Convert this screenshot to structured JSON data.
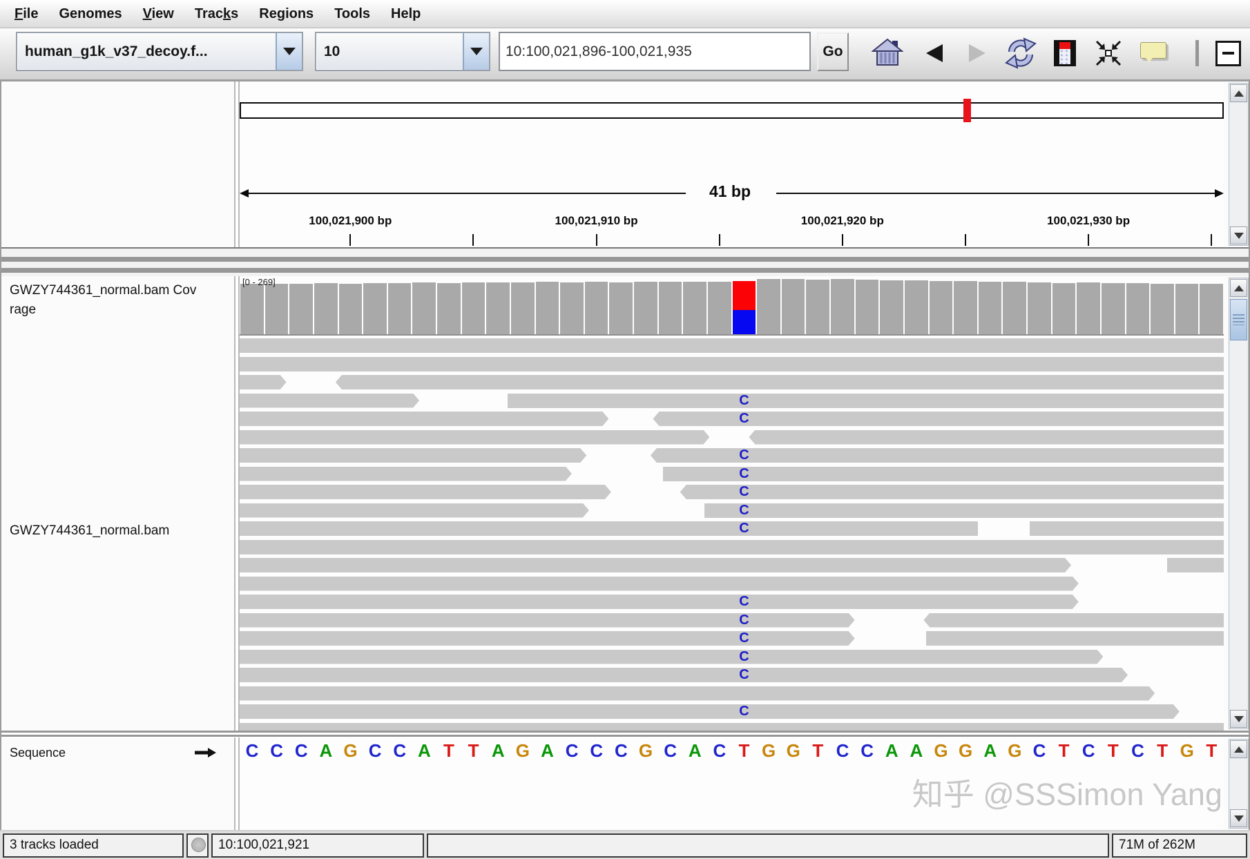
{
  "menu_bar": {
    "items": [
      {
        "label": "File",
        "underline_index": 0
      },
      {
        "label": "Genomes",
        "underline_index": -1
      },
      {
        "label": "View",
        "underline_index": 0
      },
      {
        "label": "Tracks",
        "underline_index": 4
      },
      {
        "label": "Regions",
        "underline_index": 2
      },
      {
        "label": "Tools",
        "underline_index": -1
      },
      {
        "label": "Help",
        "underline_index": -1
      }
    ]
  },
  "toolbar": {
    "genome_select": {
      "value": "human_g1k_v37_decoy.f..."
    },
    "chromosome_select": {
      "value": "10"
    },
    "locus_input": {
      "value": "10:100,021,896-100,021,935"
    },
    "go_button_label": "Go",
    "icons": [
      "home",
      "back",
      "forward",
      "refresh",
      "region-of-interest",
      "fit-to-window",
      "tooltip-toggle",
      "zoom-out"
    ]
  },
  "ruler_panel": {
    "region": {
      "chromosome": "10",
      "start": 100021896,
      "end": 100021935
    },
    "span_label": "41 bp",
    "ideogram_marker_color": "#e8131b",
    "tick_positions_bp": [
      100021900,
      100021905,
      100021910,
      100021915,
      100021920,
      100021925,
      100021930,
      100021935
    ],
    "tick_labels": [
      {
        "text": "100,021,900 bp",
        "bp": 100021900
      },
      {
        "text": "100,021,910 bp",
        "bp": 100021910
      },
      {
        "text": "100,021,920 bp",
        "bp": 100021920
      },
      {
        "text": "100,021,930 bp",
        "bp": 100021930
      }
    ]
  },
  "coverage_track": {
    "label": "GWZY744361_normal.bam Coverage",
    "label_lines": [
      "GWZY744361_normal.bam Cov",
      "rage"
    ],
    "range_label": "[0 - 269]",
    "range": [
      0,
      269
    ],
    "bar_color": "#a9a9a9",
    "variant_index": 20,
    "variant_red_fraction": 0.55,
    "variant_colors": {
      "top": "#fb0207",
      "bottom": "#0708f2"
    },
    "values": [
      244,
      247,
      245,
      249,
      246,
      250,
      248,
      251,
      249,
      252,
      253,
      251,
      254,
      252,
      255,
      253,
      256,
      254,
      257,
      255,
      258,
      269,
      268,
      267,
      268,
      266,
      264,
      262,
      260,
      258,
      256,
      254,
      252,
      250,
      251,
      248,
      249,
      246,
      247,
      245
    ]
  },
  "alignment_track": {
    "label": "GWZY744361_normal.bam",
    "read_color": "#c9c9c9",
    "mismatch_base": "C",
    "mismatch_color": "#1d1dc8",
    "mismatch_index": 20,
    "rows": [
      {
        "segments": [
          [
            0,
            40,
            ""
          ]
        ],
        "mismatch": false
      },
      {
        "segments": [
          [
            0,
            40,
            ""
          ]
        ],
        "mismatch": false
      },
      {
        "segments": [
          [
            0,
            1.9,
            "r"
          ],
          [
            3.9,
            40,
            "l"
          ]
        ],
        "mismatch": false
      },
      {
        "segments": [
          [
            0,
            7.3,
            "r"
          ],
          [
            10.9,
            40,
            ""
          ]
        ],
        "mismatch": true
      },
      {
        "segments": [
          [
            0,
            15,
            "r"
          ],
          [
            16.8,
            40,
            "l"
          ]
        ],
        "mismatch": true
      },
      {
        "segments": [
          [
            0,
            19.1,
            "r"
          ],
          [
            20.7,
            40,
            "l"
          ]
        ],
        "mismatch": false
      },
      {
        "segments": [
          [
            0,
            14.1,
            "r"
          ],
          [
            16.7,
            40,
            "l"
          ]
        ],
        "mismatch": true
      },
      {
        "segments": [
          [
            0,
            13.5,
            "r"
          ],
          [
            17.2,
            40,
            ""
          ]
        ],
        "mismatch": true
      },
      {
        "segments": [
          [
            0,
            15.1,
            "r"
          ],
          [
            17.9,
            40,
            "l"
          ]
        ],
        "mismatch": true
      },
      {
        "segments": [
          [
            0,
            14.2,
            "r"
          ],
          [
            18.9,
            40,
            ""
          ]
        ],
        "mismatch": true
      },
      {
        "segments": [
          [
            0,
            30,
            ""
          ],
          [
            32.1,
            40,
            ""
          ]
        ],
        "mismatch": true
      },
      {
        "segments": [
          [
            0,
            40,
            ""
          ]
        ],
        "mismatch": false
      },
      {
        "segments": [
          [
            0,
            33.8,
            "r"
          ],
          [
            37.7,
            40,
            ""
          ]
        ],
        "mismatch": false
      },
      {
        "segments": [
          [
            0,
            34.1,
            "r"
          ]
        ],
        "mismatch": false
      },
      {
        "segments": [
          [
            0,
            34.1,
            "r"
          ]
        ],
        "mismatch": true
      },
      {
        "segments": [
          [
            0,
            25,
            "r"
          ],
          [
            27.8,
            40,
            "l"
          ]
        ],
        "mismatch": true
      },
      {
        "segments": [
          [
            0,
            25,
            "r"
          ],
          [
            27.9,
            40,
            ""
          ]
        ],
        "mismatch": true
      },
      {
        "segments": [
          [
            0,
            35.1,
            "r"
          ]
        ],
        "mismatch": true
      },
      {
        "segments": [
          [
            0,
            36.1,
            "r"
          ]
        ],
        "mismatch": true
      },
      {
        "segments": [
          [
            0,
            37.2,
            "r"
          ]
        ],
        "mismatch": false
      },
      {
        "segments": [
          [
            0,
            38.2,
            "r"
          ]
        ],
        "mismatch": true
      },
      {
        "segments": [
          [
            0,
            40,
            ""
          ]
        ],
        "mismatch": false
      }
    ]
  },
  "sequence_track": {
    "label": "Sequence",
    "sequence": "CCCAGCCATTAGACCCGCACTGGTCCAAGGAGCTCTCTGT",
    "base_colors": {
      "A": "#0b9607",
      "C": "#2126cc",
      "G": "#c8860b",
      "T": "#da1a17"
    }
  },
  "watermark": "知乎 @SSSimon Yang",
  "status_bar": {
    "cells": [
      "3 tracks loaded",
      "10:100,021,921",
      "",
      "71M of 262M"
    ]
  }
}
